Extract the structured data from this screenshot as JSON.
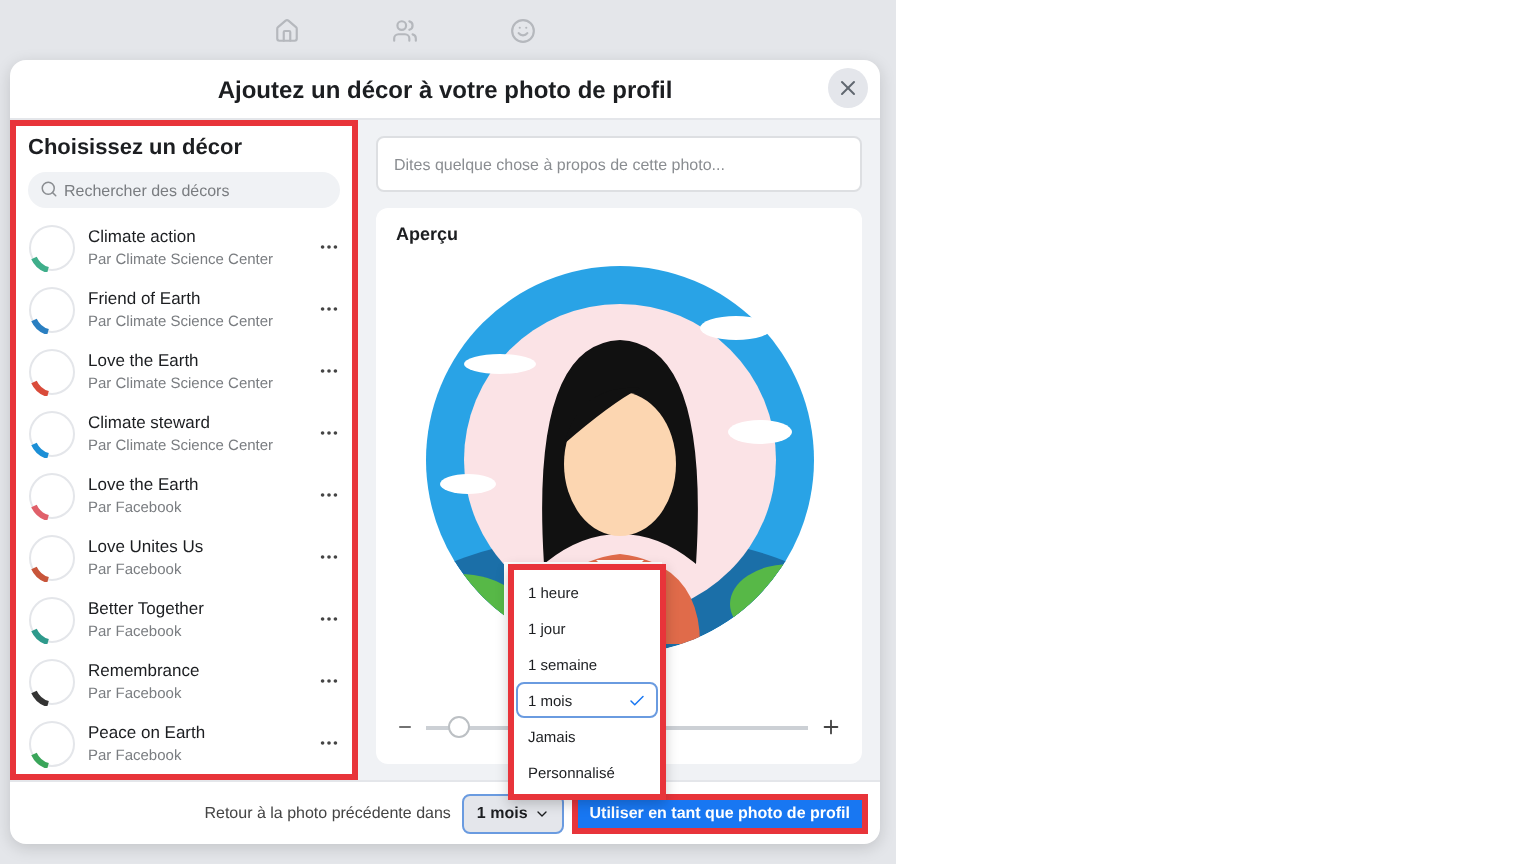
{
  "dialog": {
    "title": "Ajoutez un décor à votre photo de profil"
  },
  "sidebar": {
    "title": "Choisissez un décor",
    "search": {
      "placeholder": "Rechercher des décors"
    },
    "items": [
      {
        "name": "Climate action",
        "author": "Par Climate Science Center",
        "color": "#3fae8a"
      },
      {
        "name": "Friend of Earth",
        "author": "Par Climate Science Center",
        "color": "#2a7fc1"
      },
      {
        "name": "Love the Earth",
        "author": "Par Climate Science Center",
        "color": "#d94b3a"
      },
      {
        "name": "Climate steward",
        "author": "Par Climate Science Center",
        "color": "#1c8fd6"
      },
      {
        "name": "Love the Earth",
        "author": "Par Facebook",
        "color": "#e0606a"
      },
      {
        "name": "Love Unites Us",
        "author": "Par Facebook",
        "color": "#c8553a"
      },
      {
        "name": "Better Together",
        "author": "Par Facebook",
        "color": "#2e9a8c"
      },
      {
        "name": "Remembrance",
        "author": "Par Facebook",
        "color": "#333333"
      },
      {
        "name": "Peace on Earth",
        "author": "Par Facebook",
        "color": "#3aa55a"
      }
    ]
  },
  "caption": {
    "placeholder": "Dites quelque chose à propos de cette photo..."
  },
  "preview": {
    "title": "Aperçu",
    "zoom": {
      "level": 0.06
    }
  },
  "duration_menu": {
    "options": [
      {
        "label": "1 heure",
        "selected": false
      },
      {
        "label": "1 jour",
        "selected": false
      },
      {
        "label": "1 semaine",
        "selected": false
      },
      {
        "label": "1 mois",
        "selected": true
      },
      {
        "label": "Jamais",
        "selected": false
      },
      {
        "label": "Personnalisé",
        "selected": false
      }
    ]
  },
  "footer": {
    "label": "Retour à la photo précédente dans",
    "duration": "1 mois",
    "button": "Utiliser en tant que photo de profil"
  }
}
